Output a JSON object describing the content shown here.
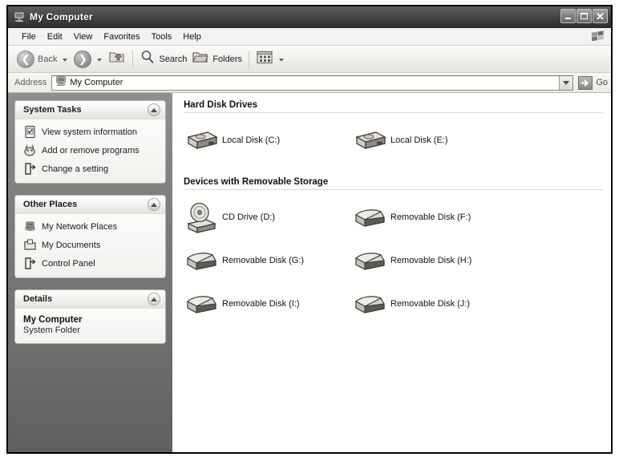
{
  "window": {
    "title": "My Computer",
    "title_icon": "my-computer-icon",
    "controls": {
      "minimize": "Minimize",
      "maximize": "Maximize",
      "close": "Close"
    }
  },
  "menubar": {
    "items": [
      {
        "label": "File"
      },
      {
        "label": "Edit"
      },
      {
        "label": "View"
      },
      {
        "label": "Favorites"
      },
      {
        "label": "Tools"
      },
      {
        "label": "Help"
      }
    ],
    "logo": "windows-flag-icon"
  },
  "toolbar": {
    "back_label": "Back",
    "forward_label": "",
    "up_label": "",
    "search_label": "Search",
    "folders_label": "Folders",
    "views_label": ""
  },
  "addressbar": {
    "label": "Address",
    "value": "My Computer",
    "icon": "my-computer-icon",
    "go_label": "Go"
  },
  "sidebar": {
    "panels": [
      {
        "title": "System Tasks",
        "items": [
          {
            "label": "View system information",
            "icon": "system-info-icon"
          },
          {
            "label": "Add or remove programs",
            "icon": "add-remove-programs-icon"
          },
          {
            "label": "Change a setting",
            "icon": "change-setting-icon"
          }
        ]
      },
      {
        "title": "Other Places",
        "items": [
          {
            "label": "My Network Places",
            "icon": "network-places-icon"
          },
          {
            "label": "My Documents",
            "icon": "my-documents-icon"
          },
          {
            "label": "Control Panel",
            "icon": "control-panel-icon"
          }
        ]
      }
    ],
    "details": {
      "title": "Details",
      "name": "My Computer",
      "type": "System Folder"
    }
  },
  "main": {
    "sections": [
      {
        "title": "Hard Disk Drives",
        "drives": [
          {
            "label": "Local Disk (C:)",
            "icon": "hard-disk-icon"
          },
          {
            "label": "Local Disk (E:)",
            "icon": "hard-disk-icon"
          }
        ]
      },
      {
        "title": "Devices with Removable Storage",
        "drives": [
          {
            "label": "CD Drive (D:)",
            "icon": "cd-drive-icon"
          },
          {
            "label": "Removable Disk (F:)",
            "icon": "removable-disk-icon"
          },
          {
            "label": "Removable Disk (G:)",
            "icon": "removable-disk-icon"
          },
          {
            "label": "Removable Disk (H:)",
            "icon": "removable-disk-icon"
          },
          {
            "label": "Removable Disk (I:)",
            "icon": "removable-disk-icon"
          },
          {
            "label": "Removable Disk (J:)",
            "icon": "removable-disk-icon"
          }
        ]
      }
    ]
  },
  "colors": {
    "titlebar": "#4a4a4a",
    "sidebar": "#7e7e7e",
    "panel_bg": "#f6f5f2",
    "text": "#101010"
  }
}
